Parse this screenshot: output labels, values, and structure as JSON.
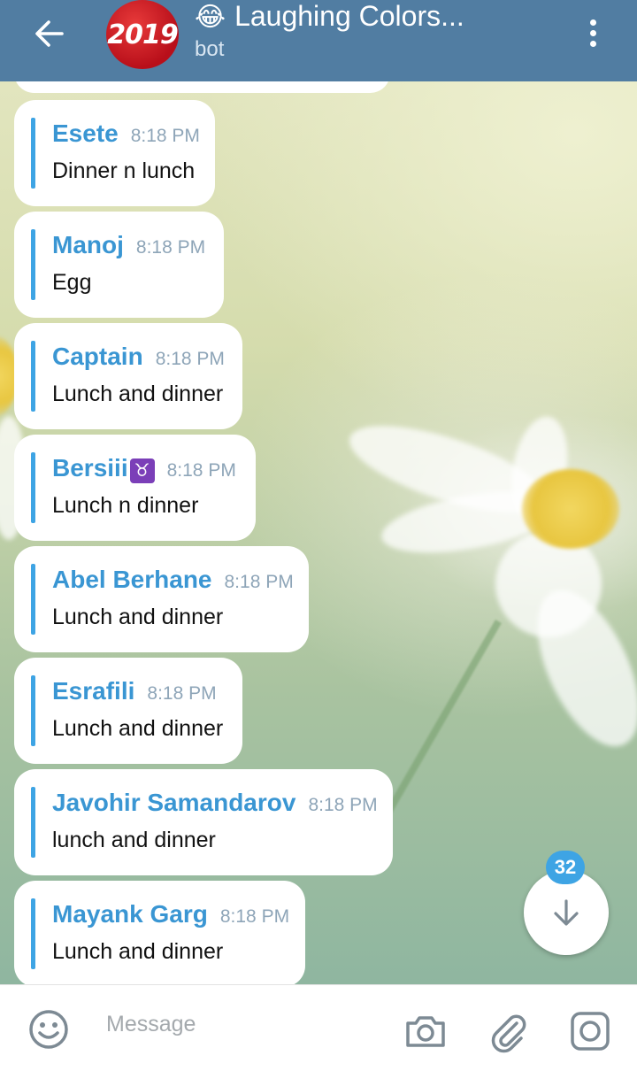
{
  "header": {
    "title_emoji": "😂",
    "title": "Laughing Colors...",
    "subtitle": "bot",
    "avatar_text": "2019"
  },
  "messages": [
    {
      "name": "Esete",
      "time": "8:18 PM",
      "text": "Dinner n lunch"
    },
    {
      "name": "Manoj",
      "time": "8:18 PM",
      "text": "Egg"
    },
    {
      "name": "Captain",
      "time": "8:18 PM",
      "text": "Lunch and dinner"
    },
    {
      "name": "Bersiii",
      "name_emoji": "♉",
      "time": "8:18 PM",
      "text": "Lunch n dinner"
    },
    {
      "name": "Abel Berhane",
      "time": "8:18 PM",
      "text": "Lunch and dinner"
    },
    {
      "name": "Esrafili",
      "time": "8:18 PM",
      "text": "Lunch and dinner"
    },
    {
      "name": "Javohir Samandarov",
      "time": "8:18 PM",
      "text": "lunch and dinner"
    },
    {
      "name": "Mayank Garg",
      "time": "8:18 PM",
      "text": "Lunch and dinner"
    }
  ],
  "scroll": {
    "unread_count": "32"
  },
  "input": {
    "placeholder": "Message"
  },
  "colors": {
    "header": "#517da2",
    "accent": "#3ea4e4",
    "name": "#3a96d3",
    "time": "#8ea5b8"
  },
  "icons": {
    "back": "arrow-left-icon",
    "menu": "more-vertical-icon",
    "scroll": "arrow-down-icon",
    "emoji": "smiley-icon",
    "camera": "camera-icon",
    "attach": "paperclip-icon",
    "instant": "instant-camera-icon"
  }
}
